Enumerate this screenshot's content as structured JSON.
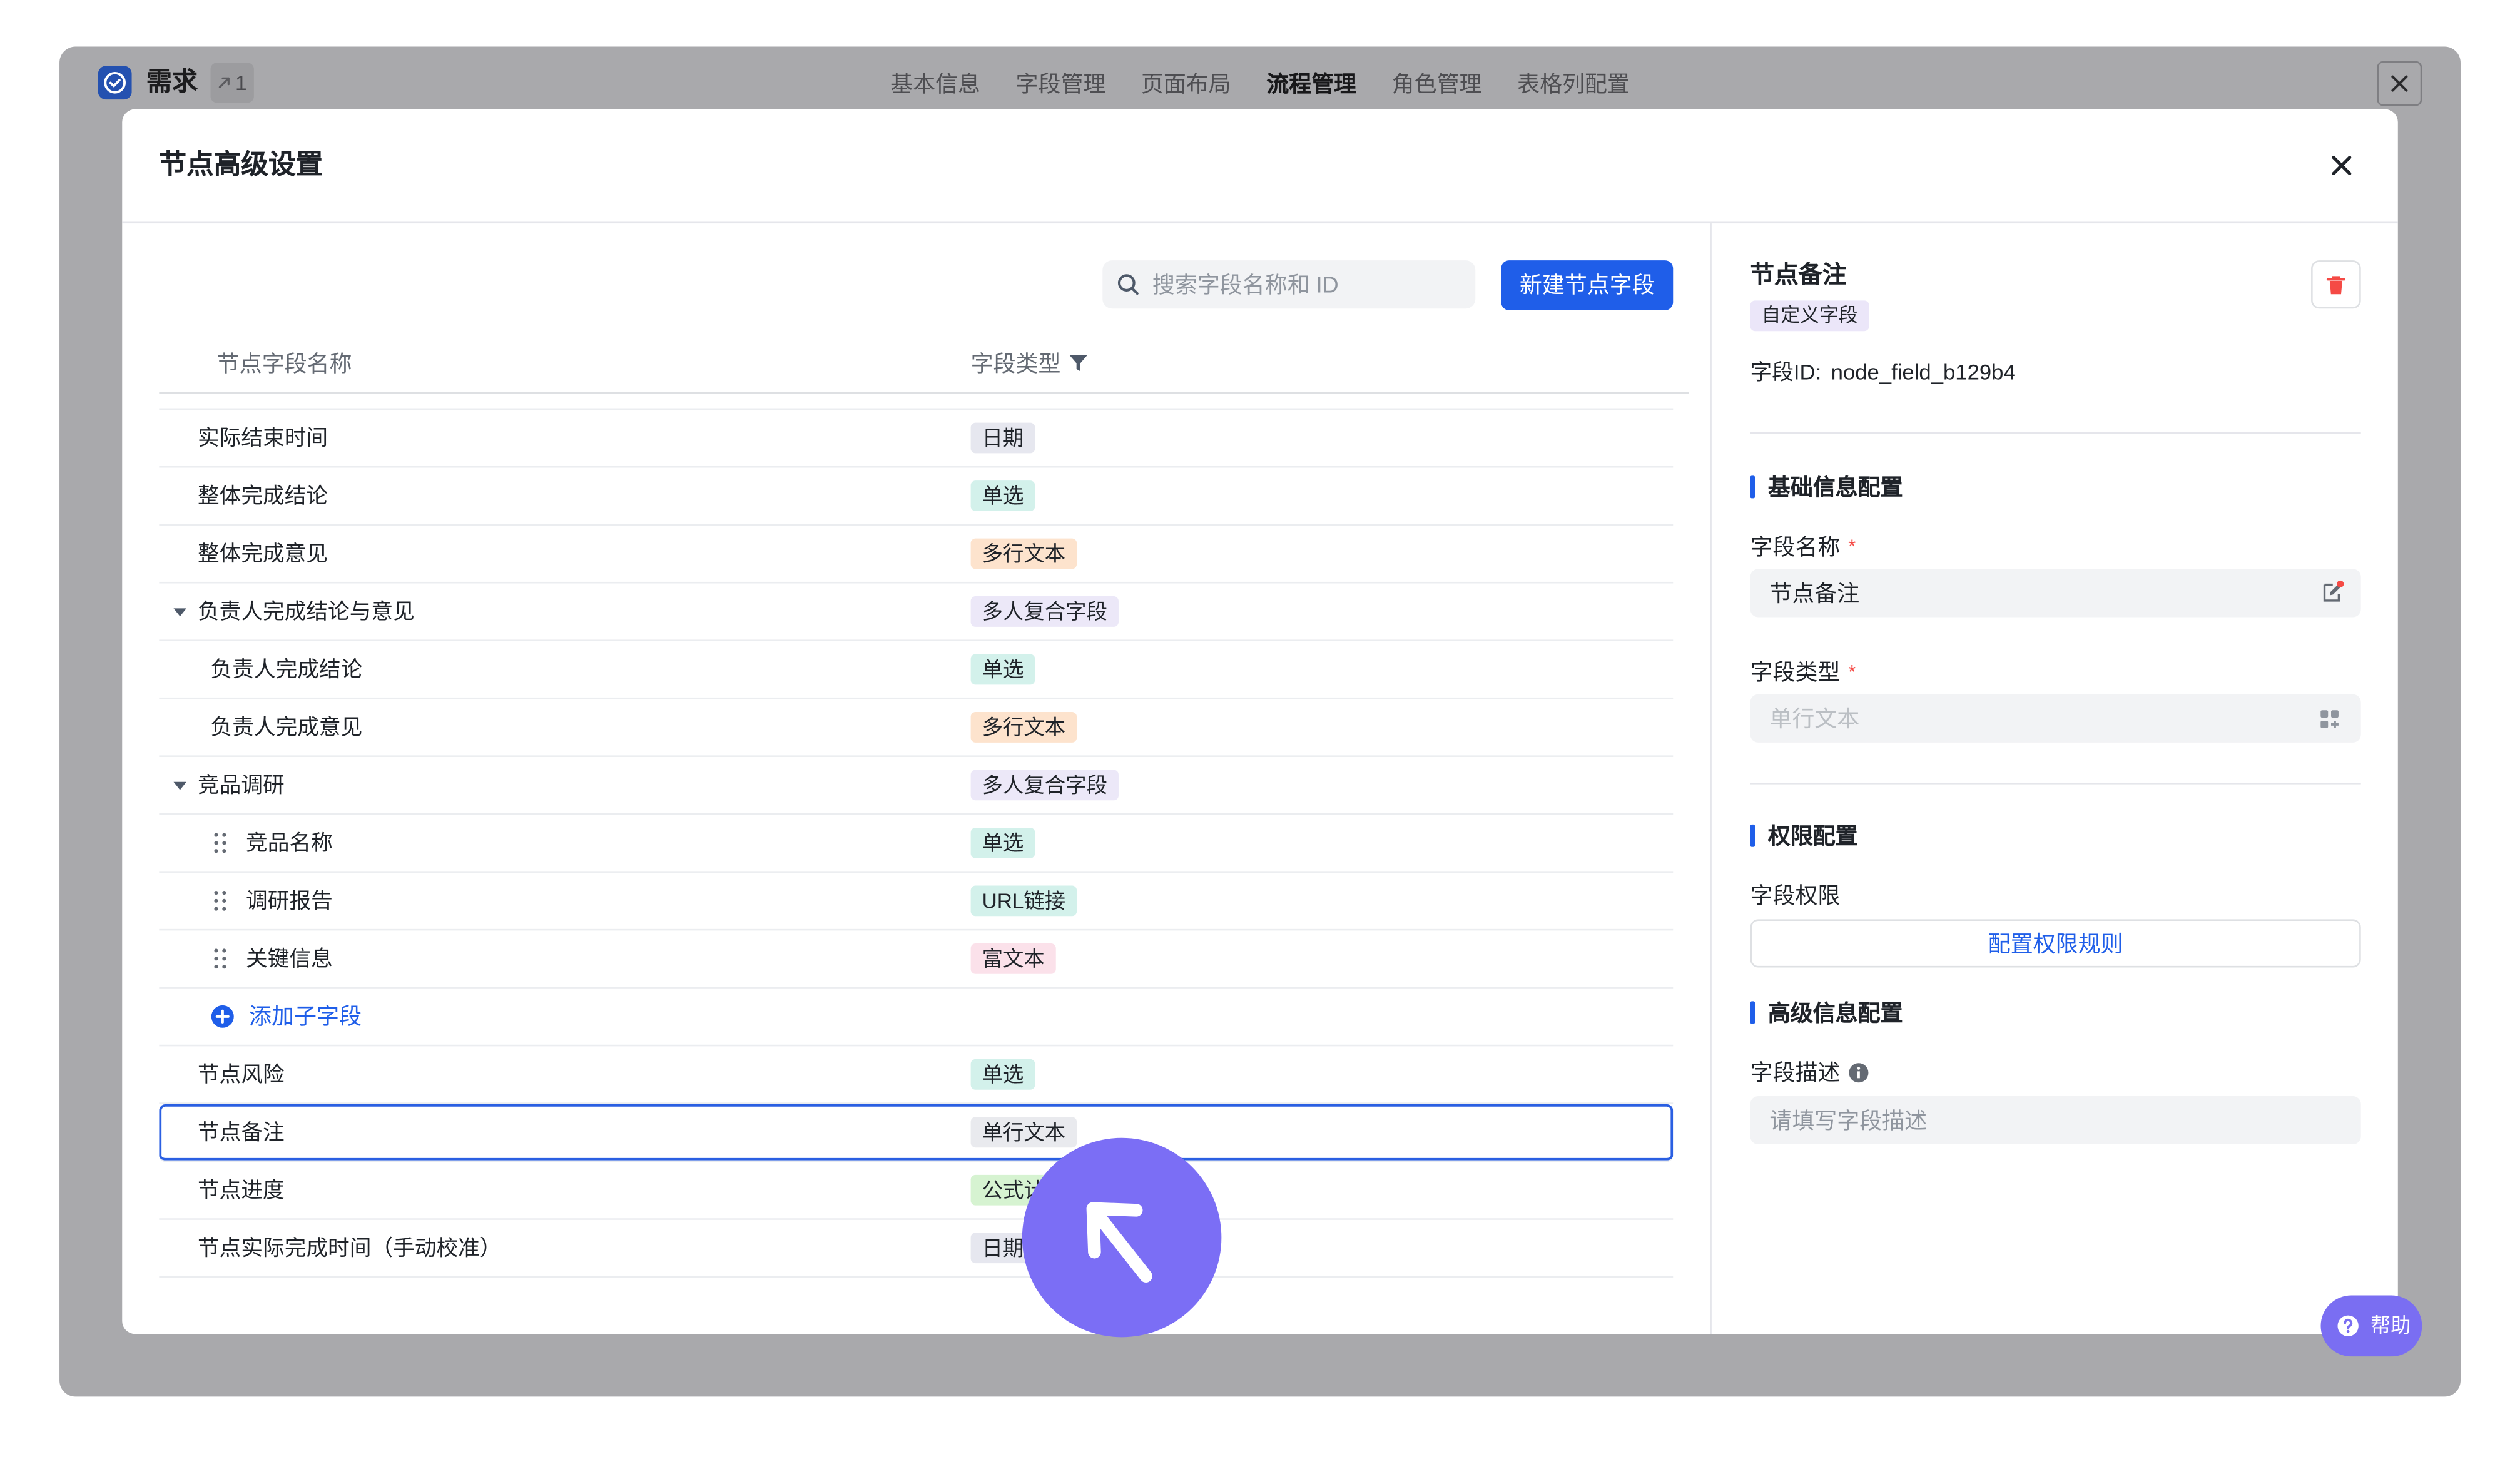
{
  "window": {
    "app_title": "需求",
    "app_icon": "circle-check-icon",
    "badge_icon": "share-icon",
    "badge_count": "1",
    "tabs": [
      {
        "label": "基本信息",
        "active": false
      },
      {
        "label": "字段管理",
        "active": false
      },
      {
        "label": "页面布局",
        "active": false
      },
      {
        "label": "流程管理",
        "active": true
      },
      {
        "label": "角色管理",
        "active": false
      },
      {
        "label": "表格列配置",
        "active": false
      }
    ]
  },
  "modal": {
    "title": "节点高级设置",
    "search_placeholder": "搜索字段名称和 ID",
    "new_field_button": "新建节点字段",
    "columns": {
      "name": "节点字段名称",
      "type": "字段类型"
    },
    "rows": [
      {
        "name": "实际结束时间",
        "type": "日期",
        "tag_color": "#e6e7ef",
        "depth": 0
      },
      {
        "name": "整体完成结论",
        "type": "单选",
        "tag_color": "#d3f1eb",
        "depth": 0
      },
      {
        "name": "整体完成意见",
        "type": "多行文本",
        "tag_color": "#fde3cd",
        "depth": 0
      },
      {
        "name": "负责人完成结论与意见",
        "type": "多人复合字段",
        "tag_color": "#ece8f8",
        "depth": 0,
        "expandable": true,
        "icon": "caret-down-icon"
      },
      {
        "name": "负责人完成结论",
        "type": "单选",
        "tag_color": "#d3f1eb",
        "depth": 1
      },
      {
        "name": "负责人完成意见",
        "type": "多行文本",
        "tag_color": "#fde3cd",
        "depth": 1
      },
      {
        "name": "竞品调研",
        "type": "多人复合字段",
        "tag_color": "#ece8f8",
        "depth": 0,
        "expandable": true,
        "icon": "caret-down-icon"
      },
      {
        "name": "竞品名称",
        "type": "单选",
        "tag_color": "#d3f1eb",
        "depth": 1,
        "draggable": true
      },
      {
        "name": "调研报告",
        "type": "URL链接",
        "tag_color": "#d3f1eb",
        "depth": 1,
        "draggable": true
      },
      {
        "name": "关键信息",
        "type": "富文本",
        "tag_color": "#fbe1ea",
        "depth": 1,
        "draggable": true
      },
      {
        "action_label": "添加子字段",
        "depth": 1,
        "icon": "plus-circle-icon"
      },
      {
        "name": "节点风险",
        "type": "单选",
        "tag_color": "#d3f1eb",
        "depth": 0
      },
      {
        "name": "节点备注",
        "type": "单行文本",
        "tag_color": "#e9eaee",
        "depth": 0,
        "selected": true
      },
      {
        "name": "节点进度",
        "type": "公式计算",
        "tag_color": "#d6f3d1",
        "depth": 0
      },
      {
        "name": "节点实际完成时间（手动校准）",
        "type": "日期",
        "tag_color": "#e6e7ef",
        "depth": 0
      }
    ]
  },
  "detail": {
    "title": "节点备注",
    "tag": "自定义字段",
    "field_id_label": "字段ID:",
    "field_id": "node_field_b129b4",
    "basic_section": "基础信息配置",
    "name_label": "字段名称",
    "name_value": "节点备注",
    "type_label": "字段类型",
    "type_value": "单行文本",
    "required_mark": "*",
    "permission_section": "权限配置",
    "permission_label": "字段权限",
    "permission_button": "配置权限规则",
    "advanced_section": "高级信息配置",
    "description_label": "字段描述",
    "description_placeholder": "请填写字段描述"
  },
  "help_label": "帮助",
  "colors": {
    "accent": "#1f5ee9",
    "danger": "#f54a45",
    "help": "#7a6ef2",
    "overlay": "#a9a9ac"
  }
}
